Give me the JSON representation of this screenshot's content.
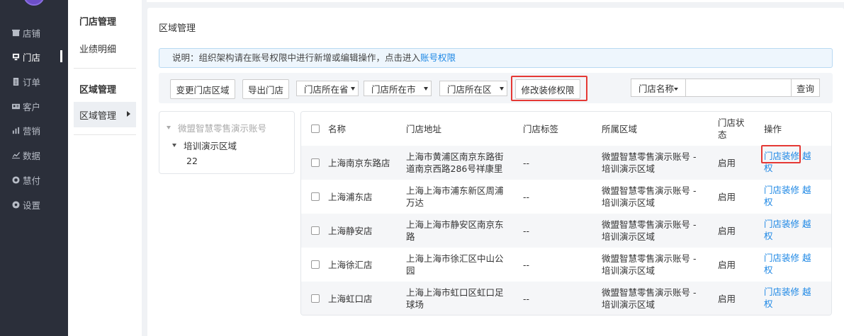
{
  "sidebar": {
    "items": [
      {
        "label": "店铺",
        "icon": "shop-icon"
      },
      {
        "label": "门店",
        "icon": "store-icon"
      },
      {
        "label": "订单",
        "icon": "order-icon"
      },
      {
        "label": "客户",
        "icon": "customer-icon"
      },
      {
        "label": "营销",
        "icon": "marketing-icon"
      },
      {
        "label": "数据",
        "icon": "data-icon"
      },
      {
        "label": "慧付",
        "icon": "pay-icon"
      },
      {
        "label": "设置",
        "icon": "settings-icon"
      }
    ],
    "active_index": 1
  },
  "subnav": {
    "group1_title": "门店管理",
    "group1_link": "业绩明细",
    "group2_title": "区域管理",
    "active_item": "区域管理"
  },
  "page": {
    "title": "区域管理",
    "notice_text": "说明：组织架构请在账号权限中进行新增或编辑操作，点击进入",
    "notice_link": "账号权限"
  },
  "toolbar": {
    "change_region": "变更门店区域",
    "export": "导出门店",
    "province_select": "门店所在省",
    "city_select": "门店所在市",
    "district_select": "门店所在区",
    "modify_perm": "修改装修权限",
    "search_type": "门店名称",
    "search_value": "",
    "search_button": "查询"
  },
  "tree": {
    "root": "微盟智慧零售演示账号",
    "child": "培训演示区域",
    "leaf": "22"
  },
  "table": {
    "columns": {
      "name": "名称",
      "address": "门店地址",
      "tags": "门店标签",
      "region": "所属区域",
      "status": "门店状态",
      "ops": "操作"
    },
    "rows": [
      {
        "name": "上海南京东路店",
        "address": "上海市黄浦区南京东路街道南京西路286号祥康里",
        "tags": "--",
        "region": "微盟智慧零售演示账号 - 培训演示区域",
        "status": "启用",
        "op1": "门店装修",
        "op2": "越权"
      },
      {
        "name": "上海浦东店",
        "address": "上海上海市浦东新区周浦万达",
        "tags": "--",
        "region": "微盟智慧零售演示账号 - 培训演示区域",
        "status": "启用",
        "op1": "门店装修",
        "op2": "越权"
      },
      {
        "name": "上海静安店",
        "address": "上海上海市静安区南京东路",
        "tags": "--",
        "region": "微盟智慧零售演示账号 - 培训演示区域",
        "status": "启用",
        "op1": "门店装修",
        "op2": "越权"
      },
      {
        "name": "上海徐汇店",
        "address": "上海上海市徐汇区中山公园",
        "tags": "--",
        "region": "微盟智慧零售演示账号 - 培训演示区域",
        "status": "启用",
        "op1": "门店装修",
        "op2": "越权"
      },
      {
        "name": "上海虹口店",
        "address": "上海上海市虹口区虹口足球场",
        "tags": "--",
        "region": "微盟智慧零售演示账号 - 培训演示区域",
        "status": "启用",
        "op1": "门店装修",
        "op2": "越权"
      }
    ]
  },
  "colors": {
    "sidebar_bg": "#2b2f3a",
    "link": "#1e88e5",
    "highlight": "#e53935"
  }
}
